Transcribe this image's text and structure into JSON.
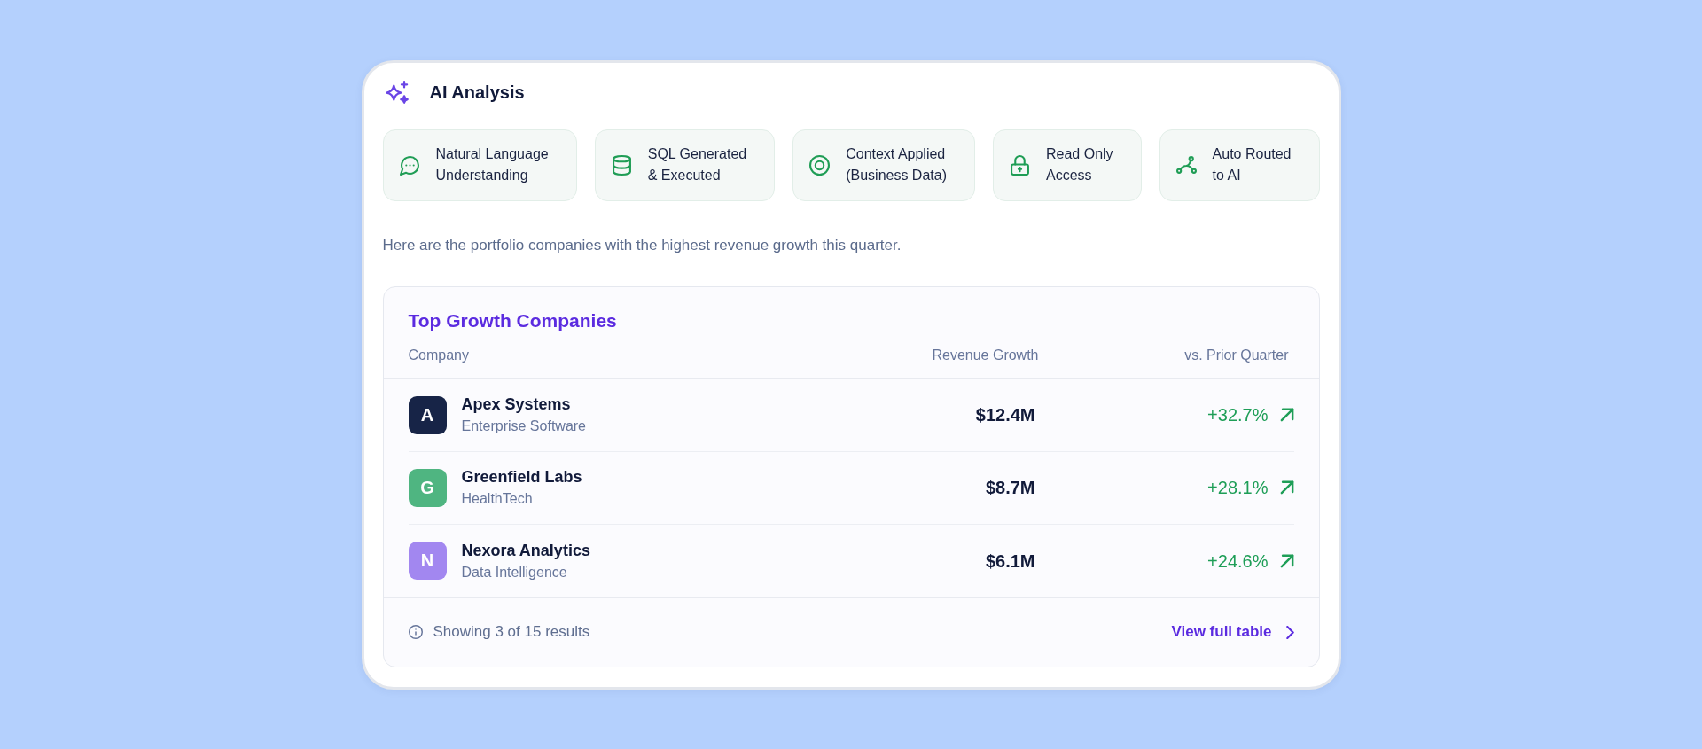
{
  "panel": {
    "title": "AI Analysis"
  },
  "capabilities": [
    {
      "label": "Natural Language\nUnderstanding"
    },
    {
      "label": "SQL Generated\n& Executed"
    },
    {
      "label": "Context Applied\n(Business Data)"
    },
    {
      "label": "Read Only\nAccess"
    },
    {
      "label": "Auto Routed\nto AI"
    }
  ],
  "summary": "Here are the portfolio companies with the highest revenue growth this quarter.",
  "results_table": {
    "title": "Top Growth Companies",
    "columns": [
      "Company",
      "Revenue Growth",
      "vs. Prior Quarter"
    ],
    "rows": [
      {
        "initial": "A",
        "color": "#172447",
        "company": "Apex Systems",
        "sector": "Enterprise Software",
        "revenue_growth": "$12.4M",
        "vs_prior_quarter": "+32.7%"
      },
      {
        "initial": "G",
        "color": "#4fb581",
        "company": "Greenfield Labs",
        "sector": "HealthTech",
        "revenue_growth": "$8.7M",
        "vs_prior_quarter": "+28.1%"
      },
      {
        "initial": "N",
        "color": "#a287f0",
        "company": "Nexora Analytics",
        "sector": "Data Intelligence",
        "revenue_growth": "$6.1M",
        "vs_prior_quarter": "+24.6%"
      }
    ],
    "footer": {
      "summary": "Showing 3 of 15 results",
      "link": "View full table"
    }
  }
}
